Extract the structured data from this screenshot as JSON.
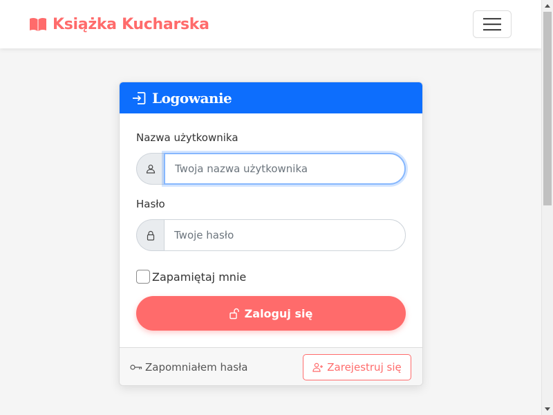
{
  "navbar": {
    "brand": "Książka Kucharska",
    "brand_icon": "book-open-icon",
    "toggler_icon": "hamburger-menu-icon"
  },
  "login_card": {
    "title": "Logowanie",
    "title_icon": "login-arrow-icon",
    "username": {
      "label": "Nazwa użytkownika",
      "placeholder": "Twoja nazwa użytkownika",
      "icon": "person-icon"
    },
    "password": {
      "label": "Hasło",
      "placeholder": "Twoje hasło",
      "icon": "lock-icon"
    },
    "remember_label": "Zapamiętaj mnie",
    "login_button": "Zaloguj się",
    "login_icon": "unlock-icon",
    "forgot_link": "Zapomniałem hasła",
    "forgot_icon": "key-icon",
    "register_button": "Zarejestruj się",
    "register_icon": "person-plus-icon"
  },
  "colors": {
    "brand": "#ff6b6b",
    "header": "#0d6efd",
    "focus": "#86b7fe"
  }
}
